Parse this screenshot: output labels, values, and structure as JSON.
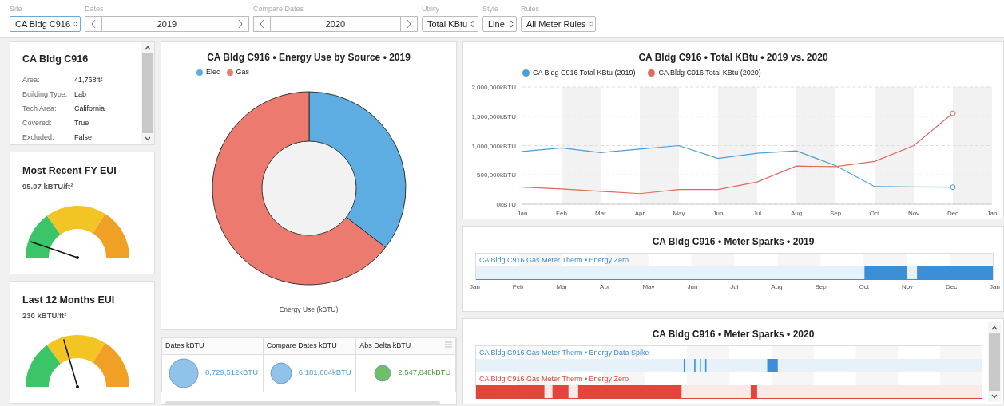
{
  "toolbar": {
    "site": {
      "label": "Site",
      "value": "CA Bldg C916"
    },
    "dates": {
      "label": "Dates",
      "value": "2019"
    },
    "compare_dates": {
      "label": "Compare Dates",
      "value": "2020"
    },
    "utility": {
      "label": "Utility",
      "value": "Total KBtu"
    },
    "style": {
      "label": "Style",
      "value": "Line"
    },
    "rules": {
      "label": "Rules",
      "value": "All Meter Rules"
    }
  },
  "building": {
    "title": "CA Bldg C916",
    "fields": [
      {
        "label": "Area:",
        "value": "41,768ft²"
      },
      {
        "label": "Building Type:",
        "value": "Lab"
      },
      {
        "label": "Tech Area:",
        "value": "California"
      },
      {
        "label": "Covered:",
        "value": "True"
      },
      {
        "label": "Excluded:",
        "value": "False"
      }
    ]
  },
  "gauges": [
    {
      "title": "Most Recent FY EUI",
      "value": "95.07 kBTU/ft²",
      "level": 0.105
    },
    {
      "title": "Last 12 Months EUI",
      "value": "230 kBTU/ft²",
      "level": 0.41
    }
  ],
  "energy_by_source": {
    "title": "CA Bldg C916 • Energy Use by Source  •  2019",
    "legend": [
      {
        "label": "Elec",
        "color": "#5dade2"
      },
      {
        "label": "Gas",
        "color": "#ec7a6f"
      }
    ],
    "axis_label": "Energy Use (kBTU)"
  },
  "totals_table": {
    "columns": [
      "Dates kBTU",
      "Compare Dates kBTU",
      "Abs Delta kBTU"
    ],
    "cells": [
      {
        "value": "8,729,512kBTU",
        "color": "#8fc3ea"
      },
      {
        "value": "6,181,664kBTU",
        "color": "#8fc3ea"
      },
      {
        "value": "2,547,848kBTU",
        "color": "#6fbf6a"
      }
    ]
  },
  "total_chart": {
    "chart_data": {
      "type": "line",
      "title": "CA Bldg C916  •  Total KBtu  •  2019 vs. 2020",
      "categories": [
        "Jan",
        "Feb",
        "Mar",
        "Apr",
        "May",
        "Jun",
        "Jul",
        "Aug",
        "Sep",
        "Oct",
        "Nov",
        "Dec",
        "Jan"
      ],
      "series": [
        {
          "name": "CA Bldg C916 Total KBtu (2019)",
          "color": "#4a9fd8",
          "values": [
            900000,
            960000,
            880000,
            940000,
            1000000,
            780000,
            870000,
            910000,
            660000,
            300000,
            295000,
            290000,
            null
          ]
        },
        {
          "name": "CA Bldg C916 Total KBtu (2020)",
          "color": "#e06a5c",
          "values": [
            290000,
            260000,
            220000,
            180000,
            250000,
            250000,
            380000,
            650000,
            640000,
            730000,
            1000000,
            1550000,
            null
          ]
        }
      ],
      "ylim": [
        0,
        2000000
      ],
      "grid": true,
      "legend": "top",
      "yticks": [
        {
          "value": 0,
          "label": "0kBTU"
        },
        {
          "value": 500000,
          "label": "500,000kBTU"
        },
        {
          "value": 1000000,
          "label": "1,000,000kBTU"
        },
        {
          "value": 1500000,
          "label": "1,500,000kBTU"
        },
        {
          "value": 2000000,
          "label": "2,000,000kBTU"
        }
      ]
    }
  },
  "sparks": [
    {
      "title": "CA Bldg C916  •  Meter Sparks  •  2019",
      "rows": [
        {
          "label": "CA Bldg C916 Gas Meter Therm • Energy Zero",
          "color": "#3a8fd6"
        }
      ],
      "axis_labels": [
        "Jan",
        "Feb",
        "Mar",
        "Apr",
        "May",
        "Jun",
        "Jul",
        "Aug",
        "Sep",
        "Oct",
        "Nov",
        "Dec",
        "Jan"
      ]
    },
    {
      "title": "CA Bldg C916  •  Meter Sparks  •  2020",
      "rows": [
        {
          "label": "CA Bldg C916 Gas Meter Therm • Energy Data Spike",
          "color": "#3a8fd6"
        },
        {
          "label": "CA Bldg C916 Gas Meter Therm • Energy Zero",
          "color": "#e0473a"
        }
      ]
    }
  ]
}
